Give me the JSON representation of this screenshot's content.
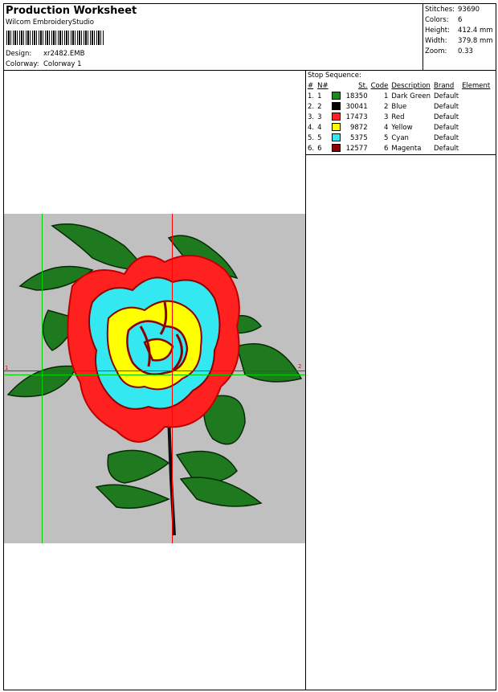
{
  "header": {
    "title": "Production Worksheet",
    "software": "Wilcom  EmbroideryStudio",
    "design_label": "Design:",
    "design_value": "xr2482.EMB",
    "colorway_label": "Colorway:",
    "colorway_value": "Colorway 1"
  },
  "stats": [
    {
      "label": "Stitches:",
      "value": "93690"
    },
    {
      "label": "Colors:",
      "value": "6"
    },
    {
      "label": "Height:",
      "value": "412.4 mm"
    },
    {
      "label": "Width:",
      "value": "379.8 mm"
    },
    {
      "label": "Zoom:",
      "value": "0.33"
    }
  ],
  "stop_sequence": {
    "title": "Stop Sequence:",
    "columns": [
      "#",
      "N#",
      "St.",
      "Code",
      "Description",
      "Brand",
      "Element"
    ],
    "rows": [
      {
        "n": "1.",
        "nn": "1",
        "color": "#1a8a1a",
        "st": "18350",
        "code": "1",
        "desc": "Dark Green",
        "brand": "Default",
        "element": ""
      },
      {
        "n": "2.",
        "nn": "2",
        "color": "#000000",
        "st": "30041",
        "code": "2",
        "desc": "Blue",
        "brand": "Default",
        "element": ""
      },
      {
        "n": "3.",
        "nn": "3",
        "color": "#ff2020",
        "st": "17473",
        "code": "3",
        "desc": "Red",
        "brand": "Default",
        "element": ""
      },
      {
        "n": "4.",
        "nn": "4",
        "color": "#ffff00",
        "st": "9872",
        "code": "4",
        "desc": "Yellow",
        "brand": "Default",
        "element": ""
      },
      {
        "n": "5.",
        "nn": "5",
        "color": "#33e8f0",
        "st": "5375",
        "code": "5",
        "desc": "Cyan",
        "brand": "Default",
        "element": ""
      },
      {
        "n": "6.",
        "nn": "6",
        "color": "#8b0000",
        "st": "12577",
        "code": "6",
        "desc": "Magenta",
        "brand": "Default",
        "element": ""
      }
    ]
  },
  "design_preview": {
    "background": "#c0c0c0",
    "guide_green": "#00cc00",
    "guide_red": "#ff0000",
    "marker_left": "1",
    "marker_right": "2"
  }
}
